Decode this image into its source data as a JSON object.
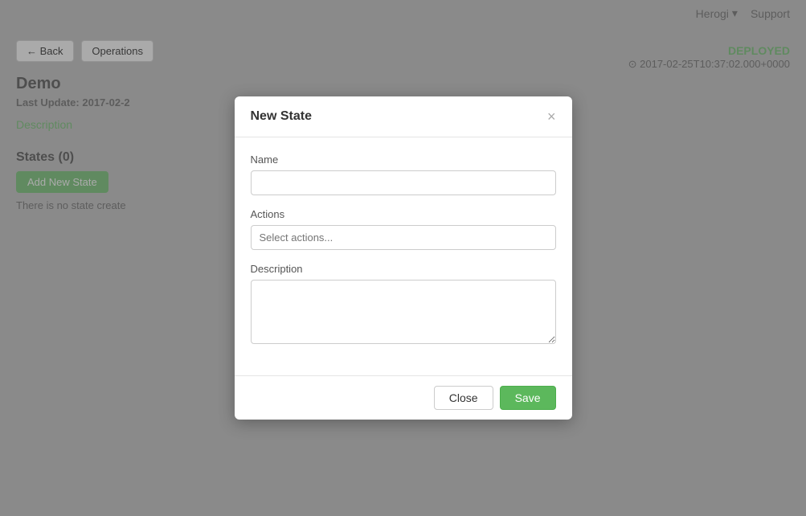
{
  "navbar": {
    "user_label": "Herogi",
    "support_label": "Support",
    "chevron": "▾"
  },
  "page": {
    "back_button": "← Back",
    "operations_button": "Operations",
    "title": "Demo",
    "last_update_label": "Last Update:",
    "last_update_value": "2017-02-2",
    "deployed_badge": "DEPLOYED",
    "deployed_time": "⊙ 2017-02-25T10:37:02.000+0000",
    "description_link": "Description",
    "states_heading": "States",
    "states_count": "(0)",
    "add_state_button": "Add New State",
    "no_state_text": "There is no state create"
  },
  "modal": {
    "title": "New State",
    "close_icon": "×",
    "name_label": "Name",
    "name_placeholder": "",
    "actions_label": "Actions",
    "actions_placeholder": "Select actions...",
    "description_label": "Description",
    "description_placeholder": "",
    "close_button": "Close",
    "save_button": "Save"
  }
}
